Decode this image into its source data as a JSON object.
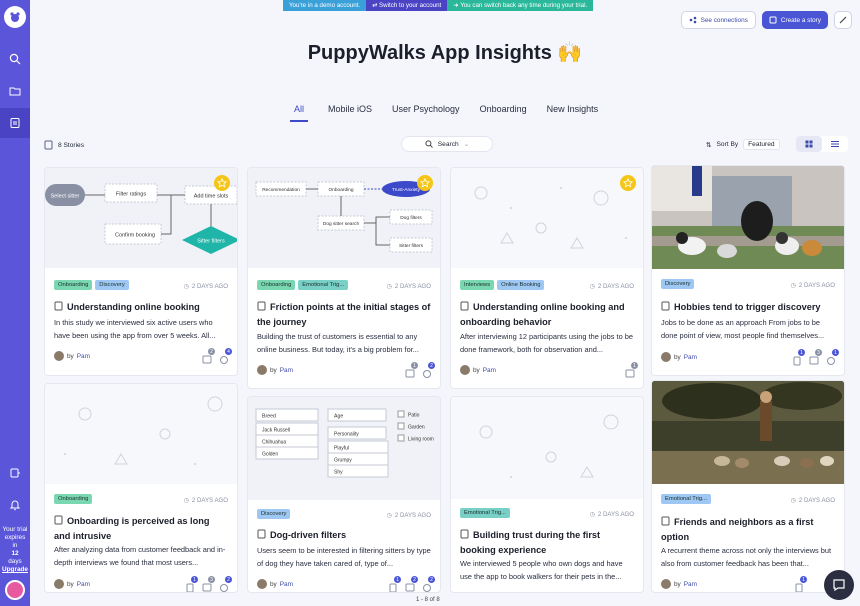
{
  "banner": {
    "demo": "You're in a demo account.",
    "switch": "Switch to your account",
    "back": "You can switch back any time during your trial."
  },
  "header": {
    "see_connections": "See connections",
    "create_story": "Create a story",
    "title": "PuppyWalks App Insights 🙌"
  },
  "tabs": [
    "All",
    "Mobile iOS",
    "User Psychology",
    "Onboarding",
    "New Insights"
  ],
  "toolbar": {
    "stories": "8 Stories",
    "search": "Search",
    "sort_label": "Sort By",
    "sort_value": "Featured"
  },
  "sidebar": {
    "trial_line1": "Your trial",
    "trial_line2": "expires",
    "trial_line3": "in",
    "trial_days": "12",
    "trial_line4": "days",
    "upgrade": "Upgrade"
  },
  "flow": {
    "c1": {
      "select": "Select sitter",
      "filter": "Filter ratings",
      "add": "Add time slots",
      "confirm": "Confirm booking",
      "sitterf": "Sitter filters"
    },
    "c2": {
      "rec": "Recommendation",
      "onb": "Onboarding",
      "trust": "Trust-Anxiety",
      "search": "Dog sitter search",
      "dogf": "Dog filters",
      "sitterf": "Sitter filters"
    },
    "c6": {
      "breed": "Breed",
      "age": "Age",
      "personality": "Personality",
      "breeds": [
        "Jack Russell",
        "Chihuahua",
        "Golden"
      ],
      "persons": [
        "Playful",
        "Grumpy",
        "Shy"
      ],
      "places": [
        "Patio",
        "Garden",
        "Living room"
      ]
    }
  },
  "cards": [
    {
      "tags": [
        "Onboarding",
        "Discovery"
      ],
      "date": "2 DAYS AGO",
      "title": "Understanding online booking",
      "desc": "In this study we interviewed six active users who have been using the app from over 5 weeks. All...",
      "author": "Pam",
      "c1": "2",
      "c2": "4"
    },
    {
      "tags": [
        "Onboarding",
        "Emotional Trig..."
      ],
      "date": "2 DAYS AGO",
      "title": "Friction points at the initial stages of the journey",
      "desc": "Building the trust of customers is essential to any online business. But today, it's a big problem for...",
      "author": "Pam",
      "c1": "1",
      "c2": "2"
    },
    {
      "tags": [
        "Interviews",
        "Online Booking"
      ],
      "date": "2 DAYS AGO",
      "title": "Understanding online booking and onboarding behavior",
      "desc": "After interviewing 12 participants using the jobs to be done framework, both for observation and...",
      "author": "Pam",
      "c1": "1"
    },
    {
      "tags": [
        "Discovery"
      ],
      "date": "2 DAYS AGO",
      "title": "Hobbies tend to trigger discovery",
      "desc": "Jobs to be done as an approach From jobs to be done point of view, most people find themselves...",
      "author": "Pam",
      "c1": "1",
      "c2": "3",
      "c3": "1"
    },
    {
      "tags": [
        "Onboarding"
      ],
      "date": "2 DAYS AGO",
      "title": "Onboarding is perceived as long and intrusive",
      "desc": "After analyzing data from customer feedback and in-depth interviews we found that most users...",
      "author": "Pam",
      "c1": "1",
      "c2": "3",
      "c3": "2"
    },
    {
      "tags": [
        "Discovery"
      ],
      "date": "2 DAYS AGO",
      "title": "Dog-driven filters",
      "desc": "Users seem to be interested in filtering sitters by type of dog they have taken cared of, type of...",
      "author": "Pam",
      "c1": "1",
      "c2": "2",
      "c3": "2"
    },
    {
      "tags": [
        "Emotional Trig..."
      ],
      "date": "2 DAYS AGO",
      "title": "Building trust during the first booking experience",
      "desc": "We interviewed 5 people who own dogs and have use the app to book walkers for their pets in the...",
      "author": "Pam"
    },
    {
      "tags": [
        "Emotional Trig..."
      ],
      "date": "2 DAYS AGO",
      "title": "Friends and neighbors as a first option",
      "desc": "A recurrent theme across not only the interviews but also from customer feedback has been that...",
      "author": "Pam",
      "c1": "1"
    }
  ],
  "pager": "1 - 8 of 8",
  "colors": {
    "sidebar": "#5b55d9",
    "accent": "#4a55d6",
    "star": "#f5c518"
  }
}
